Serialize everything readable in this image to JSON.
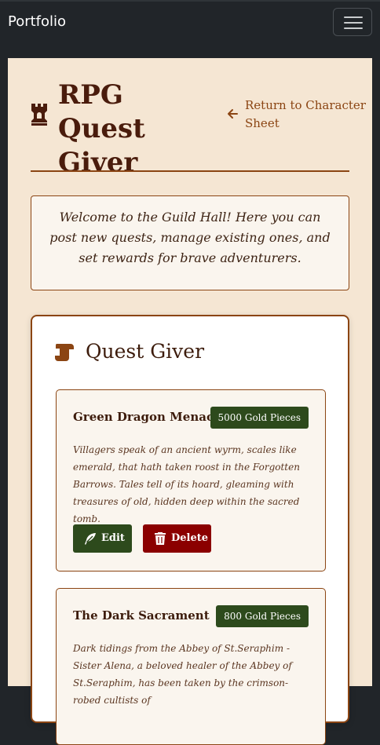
{
  "navbar": {
    "brand": "Portfolio"
  },
  "header": {
    "title": "RPG Quest Giver",
    "return_link": "Return to Character Sheet"
  },
  "welcome_text": "Welcome to the Guild Hall! Here you can post new quests, manage existing ones, and set rewards for brave adventurers.",
  "card": {
    "title": "Quest Giver",
    "quests": [
      {
        "title": "Green Dragon Menace",
        "reward": "5000 Gold Pieces",
        "description": "Villagers speak of an ancient wyrm, scales like emerald, that hath taken roost in the Forgotten Barrows. Tales tell of its hoard, gleaming with treasures of old, hidden deep within the sacred tomb."
      },
      {
        "title": "The Dark Sacrament",
        "reward": "800 Gold Pieces",
        "description": "Dark tidings from the Abbey of St.Seraphim - Sister Alena, a beloved healer of the Abbey of St.Seraphim, has been taken by the crimson-robed cultists of"
      }
    ],
    "edit_label": "Edit",
    "delete_label": "Delete"
  },
  "colors": {
    "navbar_bg": "#212529",
    "panel_bg": "#f5e6d3",
    "accent_brown": "#8b4513",
    "title_brown": "#4a1c0c",
    "reward_green": "#2d4a1c",
    "delete_red": "#8b0000"
  },
  "icons": {
    "title": "chess-rook-icon",
    "return": "arrow-left-icon",
    "card": "scroll-icon",
    "edit": "feather-icon",
    "delete": "trash-icon",
    "menu": "hamburger-menu-icon"
  }
}
